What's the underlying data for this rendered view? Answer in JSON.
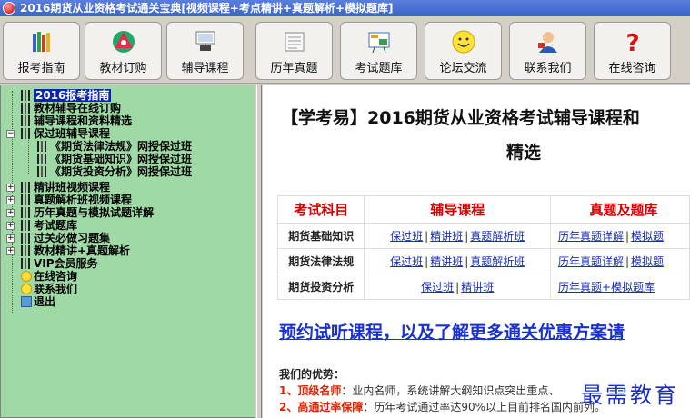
{
  "window": {
    "title": "2016期货从业资格考试通关宝典[视频课程+考点精讲+真题解析+模拟题库]"
  },
  "toolbar": {
    "buttons": [
      {
        "label": "报考指南",
        "icon": "books-icon"
      },
      {
        "label": "教材订购",
        "icon": "cd-icon"
      },
      {
        "label": "辅导课程",
        "icon": "projector-icon"
      },
      {
        "label": "历年真题",
        "icon": "newspaper-icon"
      },
      {
        "label": "考试题库",
        "icon": "exam-board-icon"
      },
      {
        "label": "论坛交流",
        "icon": "smiley-icon"
      },
      {
        "label": "联系我们",
        "icon": "user-contact-icon"
      },
      {
        "label": "在线咨询",
        "icon": "question-icon"
      }
    ]
  },
  "tree": {
    "items": [
      {
        "label": "2016报考指南"
      },
      {
        "label": "教材辅导在线订购"
      },
      {
        "label": "辅导课程和资料精选"
      },
      {
        "label": "保过班辅导课程"
      },
      {
        "label": "《期货法律法规》网授保过班"
      },
      {
        "label": "《期货基础知识》网授保过班"
      },
      {
        "label": "《期货投资分析》网授保过班"
      },
      {
        "label": "精讲班视频课程"
      },
      {
        "label": "真题解析班视频课程"
      },
      {
        "label": "历年真题与模拟试题详解"
      },
      {
        "label": "考试题库"
      },
      {
        "label": "过关必做习题集"
      },
      {
        "label": "教材精讲+真题解析"
      },
      {
        "label": "VIP会员服务"
      },
      {
        "label": "在线咨询"
      },
      {
        "label": "联系我们"
      },
      {
        "label": "退出"
      }
    ]
  },
  "content": {
    "heading_line1": "【学考易】2016期货从业资格考试辅导课程和",
    "heading_line2": "精选",
    "table": {
      "headers": [
        "考试科目",
        "辅导课程",
        "真题及题库"
      ],
      "rows": [
        {
          "subject": "期货基础知识",
          "courses": [
            "保过班",
            "精讲班",
            "真题解析班"
          ],
          "bank": [
            "历年真题详解",
            "模拟题"
          ]
        },
        {
          "subject": "期货法律法规",
          "courses": [
            "保过班",
            "精讲班",
            "真题解析班"
          ],
          "bank": [
            "历年真题详解",
            "模拟题"
          ]
        },
        {
          "subject": "期货投资分析",
          "courses": [
            "保过班",
            "精讲班"
          ],
          "bank": [
            "历年真题+模拟题库"
          ]
        }
      ]
    },
    "promo": "预约试听课程，以及了解更多通关优惠方案请",
    "advantages_title": "我们的优势：",
    "advantages": [
      {
        "key": "1、顶级名师",
        "text": "：业内名师，系统讲解大纲知识点突出重点、"
      },
      {
        "key": "2、高通过率保障",
        "text": "：历年考试通过率达90%以上目前排名国内前列。"
      }
    ],
    "watermark": "最需教育"
  }
}
